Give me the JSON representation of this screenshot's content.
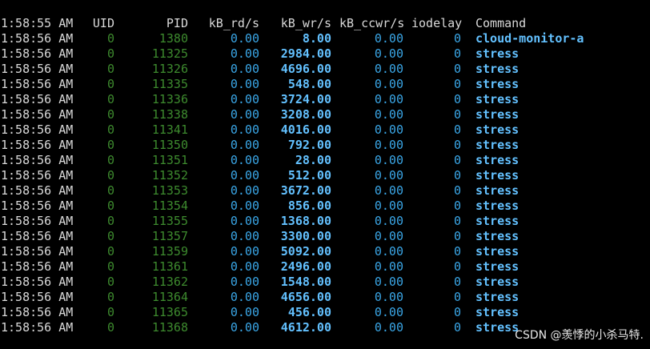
{
  "header": {
    "time": "1:58:55 AM",
    "uid": "UID",
    "pid": "PID",
    "kb_rd": "kB_rd/s",
    "kb_wr": "kB_wr/s",
    "kb_ccwr": "kB_ccwr/s",
    "iodelay": "iodelay",
    "command": "Command"
  },
  "rows": [
    {
      "time": "1:58:56 AM",
      "uid": "0",
      "pid": "1380",
      "kb_rd": "0.00",
      "kb_wr": "8.00",
      "kb_ccwr": "0.00",
      "iodelay": "0",
      "command": "cloud-monitor-a"
    },
    {
      "time": "1:58:56 AM",
      "uid": "0",
      "pid": "11325",
      "kb_rd": "0.00",
      "kb_wr": "2984.00",
      "kb_ccwr": "0.00",
      "iodelay": "0",
      "command": "stress"
    },
    {
      "time": "1:58:56 AM",
      "uid": "0",
      "pid": "11326",
      "kb_rd": "0.00",
      "kb_wr": "4696.00",
      "kb_ccwr": "0.00",
      "iodelay": "0",
      "command": "stress"
    },
    {
      "time": "1:58:56 AM",
      "uid": "0",
      "pid": "11335",
      "kb_rd": "0.00",
      "kb_wr": "548.00",
      "kb_ccwr": "0.00",
      "iodelay": "0",
      "command": "stress"
    },
    {
      "time": "1:58:56 AM",
      "uid": "0",
      "pid": "11336",
      "kb_rd": "0.00",
      "kb_wr": "3724.00",
      "kb_ccwr": "0.00",
      "iodelay": "0",
      "command": "stress"
    },
    {
      "time": "1:58:56 AM",
      "uid": "0",
      "pid": "11338",
      "kb_rd": "0.00",
      "kb_wr": "3208.00",
      "kb_ccwr": "0.00",
      "iodelay": "0",
      "command": "stress"
    },
    {
      "time": "1:58:56 AM",
      "uid": "0",
      "pid": "11341",
      "kb_rd": "0.00",
      "kb_wr": "4016.00",
      "kb_ccwr": "0.00",
      "iodelay": "0",
      "command": "stress"
    },
    {
      "time": "1:58:56 AM",
      "uid": "0",
      "pid": "11350",
      "kb_rd": "0.00",
      "kb_wr": "792.00",
      "kb_ccwr": "0.00",
      "iodelay": "0",
      "command": "stress"
    },
    {
      "time": "1:58:56 AM",
      "uid": "0",
      "pid": "11351",
      "kb_rd": "0.00",
      "kb_wr": "28.00",
      "kb_ccwr": "0.00",
      "iodelay": "0",
      "command": "stress"
    },
    {
      "time": "1:58:56 AM",
      "uid": "0",
      "pid": "11352",
      "kb_rd": "0.00",
      "kb_wr": "512.00",
      "kb_ccwr": "0.00",
      "iodelay": "0",
      "command": "stress"
    },
    {
      "time": "1:58:56 AM",
      "uid": "0",
      "pid": "11353",
      "kb_rd": "0.00",
      "kb_wr": "3672.00",
      "kb_ccwr": "0.00",
      "iodelay": "0",
      "command": "stress"
    },
    {
      "time": "1:58:56 AM",
      "uid": "0",
      "pid": "11354",
      "kb_rd": "0.00",
      "kb_wr": "856.00",
      "kb_ccwr": "0.00",
      "iodelay": "0",
      "command": "stress"
    },
    {
      "time": "1:58:56 AM",
      "uid": "0",
      "pid": "11355",
      "kb_rd": "0.00",
      "kb_wr": "1368.00",
      "kb_ccwr": "0.00",
      "iodelay": "0",
      "command": "stress"
    },
    {
      "time": "1:58:56 AM",
      "uid": "0",
      "pid": "11357",
      "kb_rd": "0.00",
      "kb_wr": "3300.00",
      "kb_ccwr": "0.00",
      "iodelay": "0",
      "command": "stress"
    },
    {
      "time": "1:58:56 AM",
      "uid": "0",
      "pid": "11359",
      "kb_rd": "0.00",
      "kb_wr": "5092.00",
      "kb_ccwr": "0.00",
      "iodelay": "0",
      "command": "stress"
    },
    {
      "time": "1:58:56 AM",
      "uid": "0",
      "pid": "11361",
      "kb_rd": "0.00",
      "kb_wr": "2496.00",
      "kb_ccwr": "0.00",
      "iodelay": "0",
      "command": "stress"
    },
    {
      "time": "1:58:56 AM",
      "uid": "0",
      "pid": "11362",
      "kb_rd": "0.00",
      "kb_wr": "1548.00",
      "kb_ccwr": "0.00",
      "iodelay": "0",
      "command": "stress"
    },
    {
      "time": "1:58:56 AM",
      "uid": "0",
      "pid": "11364",
      "kb_rd": "0.00",
      "kb_wr": "4656.00",
      "kb_ccwr": "0.00",
      "iodelay": "0",
      "command": "stress"
    },
    {
      "time": "1:58:56 AM",
      "uid": "0",
      "pid": "11365",
      "kb_rd": "0.00",
      "kb_wr": "456.00",
      "kb_ccwr": "0.00",
      "iodelay": "0",
      "command": "stress"
    },
    {
      "time": "1:58:56 AM",
      "uid": "0",
      "pid": "11368",
      "kb_rd": "0.00",
      "kb_wr": "4612.00",
      "kb_ccwr": "0.00",
      "iodelay": "0",
      "command": "stress"
    }
  ],
  "watermark": "CSDN @羡悸的小杀马特."
}
